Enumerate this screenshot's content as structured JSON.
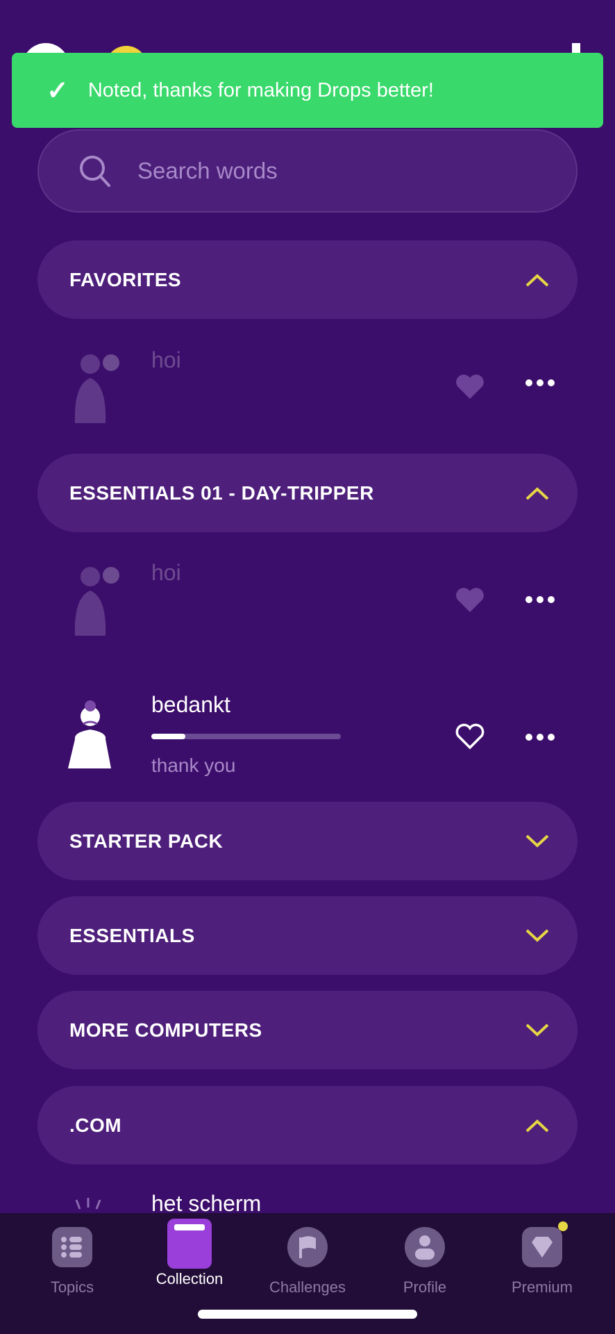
{
  "toast": {
    "icon": "checkmark-icon",
    "message": "Noted, thanks for making Drops better!",
    "color": "#39d96b"
  },
  "search": {
    "placeholder": "Search words",
    "icon": "search-icon"
  },
  "sections": [
    {
      "title": "FAVORITES",
      "expanded": true,
      "words": [
        {
          "word": "hoi",
          "faded": true
        }
      ]
    },
    {
      "title": "ESSENTIALS 01 - DAY-TRIPPER",
      "expanded": true,
      "words": [
        {
          "word": "hoi",
          "faded": true
        },
        {
          "word": "bedankt",
          "translation": "thank you",
          "progress": 0.18
        }
      ]
    },
    {
      "title": "STARTER PACK",
      "expanded": false
    },
    {
      "title": "ESSENTIALS",
      "expanded": false
    },
    {
      "title": "MORE COMPUTERS",
      "expanded": false
    },
    {
      "title": ".COM",
      "expanded": true,
      "words": [
        {
          "word": "het scherm"
        }
      ]
    }
  ],
  "tabs": [
    {
      "label": "Topics",
      "icon": "list-icon"
    },
    {
      "label": "Collection",
      "icon": "book-icon",
      "active": true
    },
    {
      "label": "Challenges",
      "icon": "flag-icon"
    },
    {
      "label": "Profile",
      "icon": "person-icon"
    },
    {
      "label": "Premium",
      "icon": "diamond-icon",
      "badge": true
    }
  ],
  "colors": {
    "background": "#3c0e6b",
    "accent": "#e6d645",
    "active_tab": "#9a3fd9"
  }
}
